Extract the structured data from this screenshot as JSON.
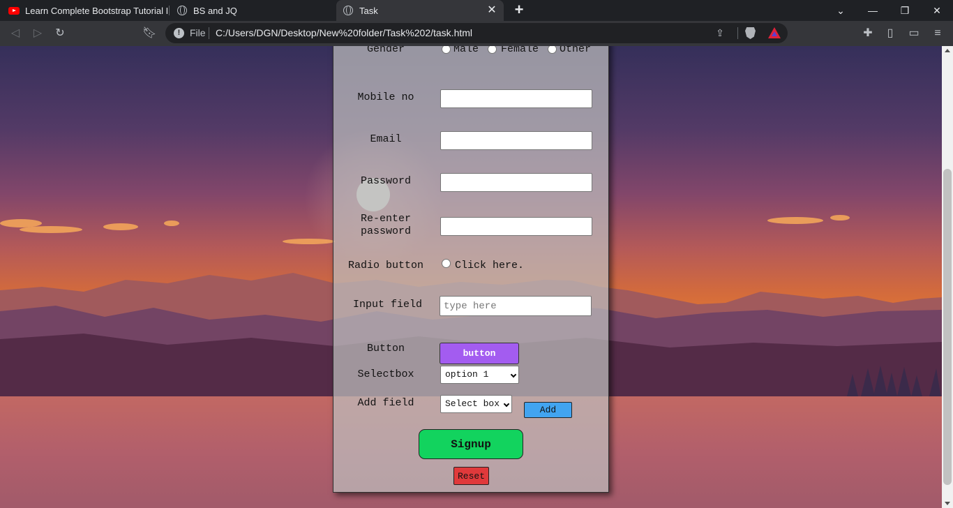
{
  "browser": {
    "tabs": [
      {
        "title": "Learn Complete Bootstrap Tutorial In",
        "icon": "youtube-icon"
      },
      {
        "title": "BS and JQ",
        "icon": "globe-icon"
      },
      {
        "title": "Task",
        "icon": "globe-icon",
        "active": true
      }
    ],
    "address": {
      "scheme_label": "File",
      "url": "C:/Users/DGN/Desktop/New%20folder/Task%202/task.html"
    }
  },
  "form": {
    "gender": {
      "label": "Gender",
      "options": [
        "Male",
        "Female",
        "Other"
      ]
    },
    "mobile": {
      "label": "Mobile no",
      "value": ""
    },
    "email": {
      "label": "Email",
      "value": ""
    },
    "password": {
      "label": "Password",
      "value": ""
    },
    "reenter": {
      "label_line1": "Re-enter",
      "label_line2": "password",
      "value": ""
    },
    "radio_button": {
      "label": "Radio button",
      "option": "Click here."
    },
    "input_field": {
      "label": "Input field",
      "placeholder": "type here",
      "value": ""
    },
    "button_row": {
      "label": "Button",
      "button_label": "button"
    },
    "selectbox": {
      "label": "Selectbox",
      "selected": "option 1"
    },
    "add_field": {
      "label": "Add field",
      "selected": "Select box",
      "add_label": "Add"
    },
    "signup_label": "Signup",
    "reset_label": "Reset"
  },
  "colors": {
    "purple_button": "#a35cf0",
    "add_button": "#42a4f0",
    "signup_button": "#12d35e",
    "reset_button": "#e0393b"
  }
}
